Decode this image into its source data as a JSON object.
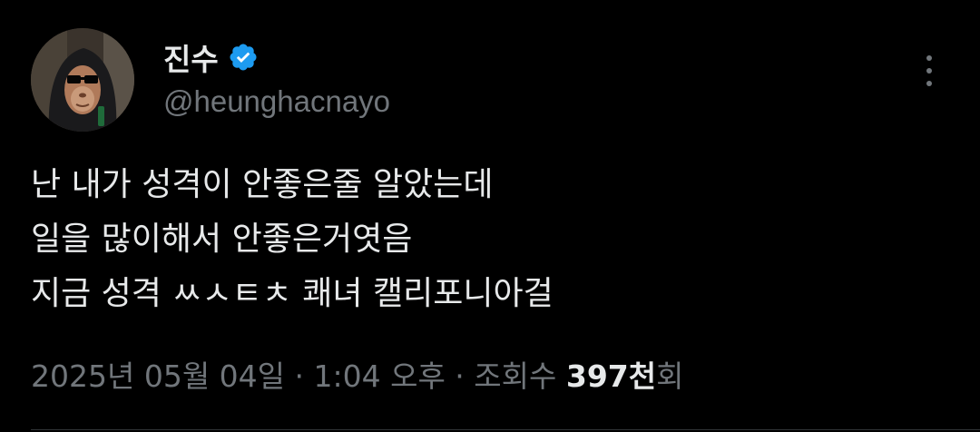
{
  "author": {
    "display_name": "진수",
    "handle": "@heunghacnayo",
    "verified": true
  },
  "tweet": {
    "lines": [
      "난 내가 성격이 안좋은줄 알았는데",
      "일을 많이해서 안좋은거엿음",
      "지금 성격 ㅆㅅㅌㅊ 쾌녀 캘리포니아걸"
    ]
  },
  "meta": {
    "timestamp": "2025년 05월 04일 · 1:04 오후",
    "separator": " · ",
    "views_label_prefix": "조회수 ",
    "views_count": "397천",
    "views_label_suffix": "회"
  },
  "colors": {
    "background": "#000000",
    "text_primary": "#e7e9ea",
    "text_secondary": "#71767b",
    "verified_badge": "#1d9bf0"
  },
  "icons": {
    "verified": "verified-badge-icon",
    "more": "more-options-icon"
  }
}
